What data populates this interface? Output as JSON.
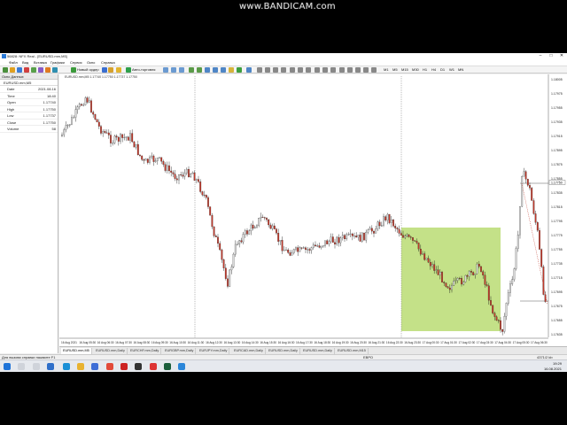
{
  "watermark": "www.BANDICAM.com",
  "window": {
    "title": "56828: NFX Real - [EURUSD.mm,M5]"
  },
  "menu": [
    "Файл",
    "Вид",
    "Вставка",
    "Графики",
    "Сервис",
    "Окно",
    "Справка"
  ],
  "toolbar": {
    "new_order": "Новый ордер",
    "auto_trading": "Авто-торговля",
    "timeframes": [
      "M1",
      "M5",
      "M15",
      "M30",
      "H1",
      "H4",
      "D1",
      "W1",
      "MN"
    ]
  },
  "data_panel": {
    "header": "Окно Данных",
    "symbol": "EURUSD.mm,M5",
    "rows": [
      {
        "key": "Date",
        "value": "2021.08.16"
      },
      {
        "key": "Time",
        "value": "18:40"
      },
      {
        "key": "Open",
        "value": "1.17740"
      },
      {
        "key": "High",
        "value": "1.17750"
      },
      {
        "key": "Low",
        "value": "1.17737"
      },
      {
        "key": "Close",
        "value": "1.17750"
      },
      {
        "key": "Volume",
        "value": "58"
      }
    ]
  },
  "chart": {
    "info": "EURUSD.mm,M5  1.17740 1.17750 1.17737 1.17750",
    "price_labels": [
      "1.18005",
      "1.17975",
      "1.17955",
      "1.17935",
      "1.17915",
      "1.17895",
      "1.17875",
      "1.17855",
      "1.17835",
      "1.17815",
      "1.17795",
      "1.17775",
      "1.17755",
      "1.17735",
      "1.17715",
      "1.17695",
      "1.17675",
      "1.17655",
      "1.17635"
    ],
    "time_labels": [
      "16 Aug 2021",
      "16 Aug 05:30",
      "16 Aug 06:30",
      "16 Aug 07:30",
      "16 Aug 08:30",
      "16 Aug 09:30",
      "16 Aug 10:30",
      "16 Aug 11:30",
      "16 Aug 12:30",
      "16 Aug 13:30",
      "16 Aug 14:30",
      "16 Aug 15:30",
      "16 Aug 16:30",
      "16 Aug 17:30",
      "16 Aug 18:30",
      "16 Aug 19:30",
      "16 Aug 20:30",
      "16 Aug 21:30",
      "16 Aug 22:30",
      "16 Aug 23:30",
      "17 Aug 00:30",
      "17 Aug 01:30",
      "17 Aug 02:30",
      "17 Aug 03:30",
      "17 Aug 04:30",
      "17 Aug 05:30",
      "17 Aug 06:30"
    ],
    "current_price": "1.17750",
    "up_color": "#d9d9d9",
    "down_color": "#c0392b",
    "wick_color": "#111111",
    "zone_color": "#b5d96a"
  },
  "chart_tabs": [
    "EURUSD.mm,M5",
    "EURUSD.mm,Daily",
    "EURCHF.mm,Daily",
    "EURGBP.mm,Daily",
    "EURJPY.mm,Daily",
    "EURCAD.mm,Daily",
    "EURUSD.mm,Daily",
    "EURUSD.mm,Daily",
    "EURUSD.mm,M15"
  ],
  "status": {
    "help": "Для вызова справки нажмите F1",
    "profile": "ЕВРО",
    "traffic": "4371/2 kb"
  },
  "clock": {
    "time": "19:29",
    "date": "16.08.2021"
  }
}
